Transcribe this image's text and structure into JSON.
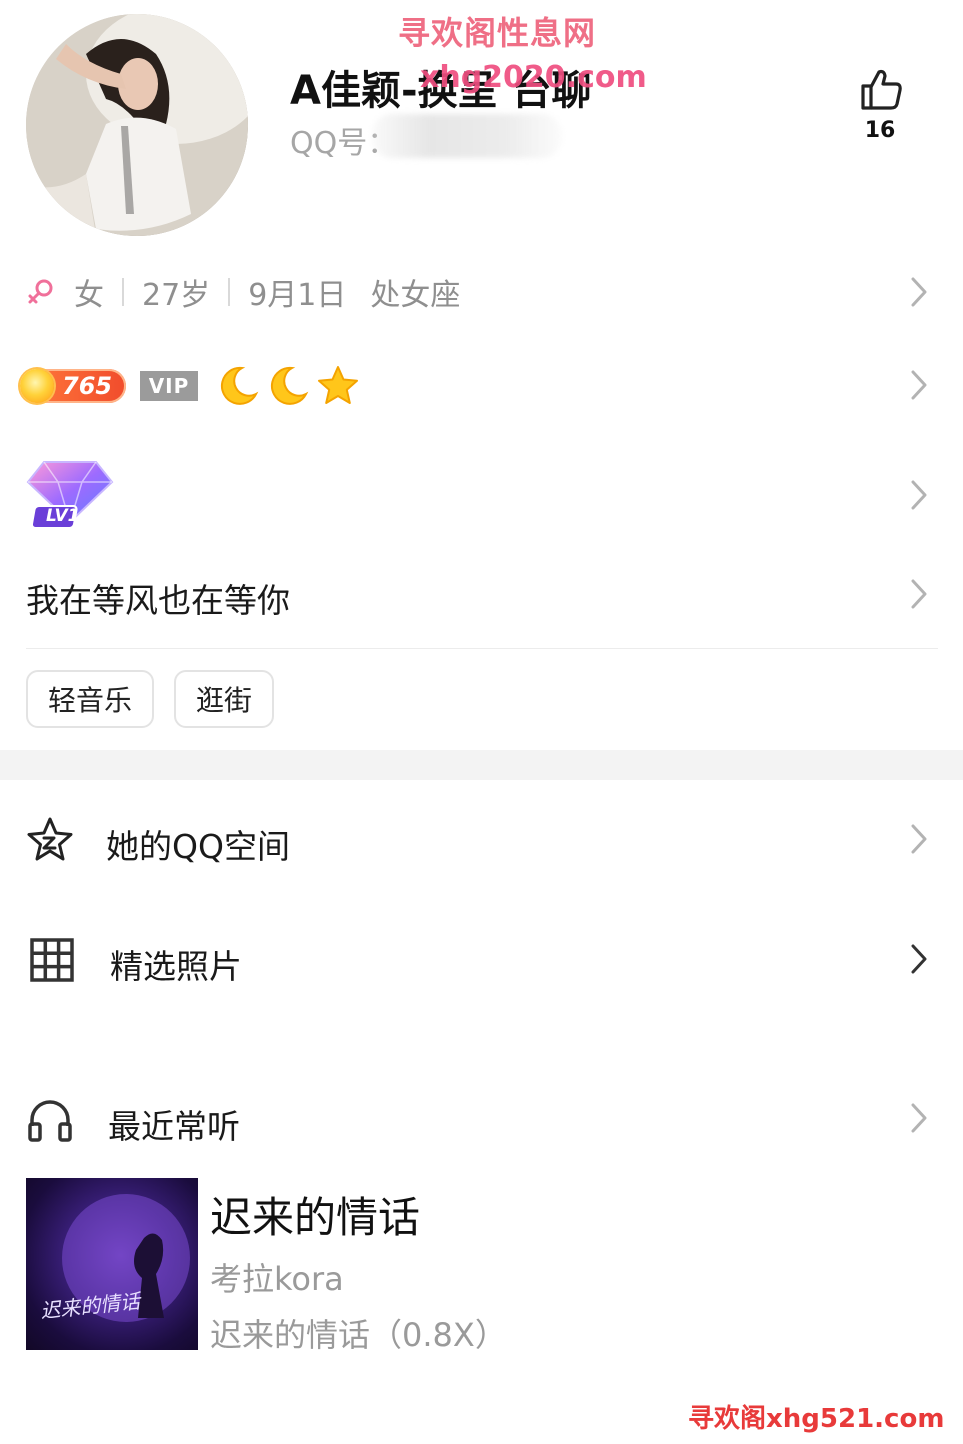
{
  "watermark": {
    "top": "寻欢阁性息网",
    "bottom": "寻欢阁xhg521.com",
    "name_overlay": "xhg2020.com"
  },
  "profile": {
    "name": "A佳颖-换呈 台聊",
    "qq_label": "QQ号：",
    "likes": "16",
    "avatar_icon": "avatar-photo"
  },
  "info": {
    "gender_icon": "female-icon",
    "gender": "女",
    "age": "27岁",
    "birthday": "9月1日",
    "zodiac": "处女座"
  },
  "badges": {
    "sun_level": "765",
    "vip": "VIP"
  },
  "level_badge": "LV1",
  "signature": "我在等风也在等你",
  "tags": [
    "轻音乐",
    "逛街"
  ],
  "menu": {
    "qzone": "她的QQ空间",
    "photos": "精选照片",
    "recent": "最近常听"
  },
  "song": {
    "title": "迟来的情话",
    "artist": "考拉kora",
    "album": "迟来的情话（0.8X）",
    "cover_text": "迟来的情话"
  },
  "colors": {
    "watermark_pink": "#ef6f86",
    "female_pink": "#f0709a",
    "vip_gray": "#9b9b9b",
    "sun_orange": "#f14c2c"
  }
}
